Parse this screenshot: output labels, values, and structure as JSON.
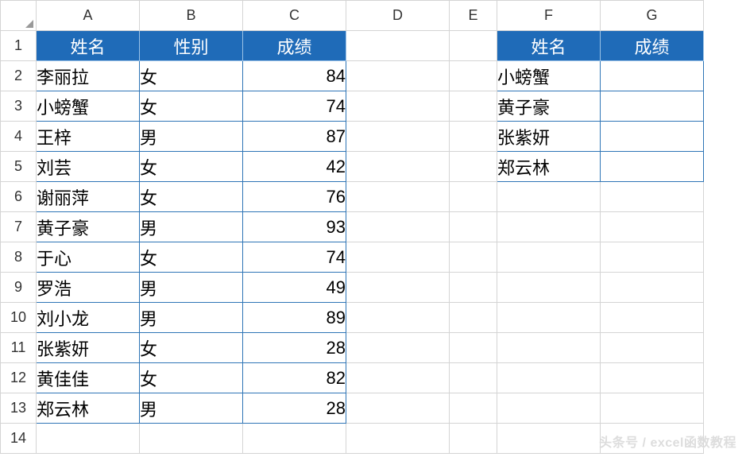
{
  "columns": [
    "A",
    "B",
    "C",
    "D",
    "E",
    "F",
    "G"
  ],
  "rows": [
    "1",
    "2",
    "3",
    "4",
    "5",
    "6",
    "7",
    "8",
    "9",
    "10",
    "11",
    "12",
    "13",
    "14"
  ],
  "table1": {
    "headers": {
      "name": "姓名",
      "gender": "性别",
      "score": "成绩"
    },
    "rows": [
      {
        "name": "李丽拉",
        "gender": "女",
        "score": "84"
      },
      {
        "name": "小螃蟹",
        "gender": "女",
        "score": "74"
      },
      {
        "name": "王梓",
        "gender": "男",
        "score": "87"
      },
      {
        "name": "刘芸",
        "gender": "女",
        "score": "42"
      },
      {
        "name": "谢丽萍",
        "gender": "女",
        "score": "76"
      },
      {
        "name": "黄子豪",
        "gender": "男",
        "score": "93"
      },
      {
        "name": "于心",
        "gender": "女",
        "score": "74"
      },
      {
        "name": "罗浩",
        "gender": "男",
        "score": "49"
      },
      {
        "name": "刘小龙",
        "gender": "男",
        "score": "89"
      },
      {
        "name": "张紫妍",
        "gender": "女",
        "score": "28"
      },
      {
        "name": "黄佳佳",
        "gender": "女",
        "score": "82"
      },
      {
        "name": "郑云林",
        "gender": "男",
        "score": "28"
      }
    ]
  },
  "table2": {
    "headers": {
      "name": "姓名",
      "score": "成绩"
    },
    "rows": [
      {
        "name": "小螃蟹",
        "score": ""
      },
      {
        "name": "黄子豪",
        "score": ""
      },
      {
        "name": "张紫妍",
        "score": ""
      },
      {
        "name": "郑云林",
        "score": ""
      }
    ]
  },
  "watermark": "头条号 / excel函数教程",
  "chart_data": {
    "type": "table",
    "tables": [
      {
        "name": "main",
        "columns": [
          "姓名",
          "性别",
          "成绩"
        ],
        "rows": [
          [
            "李丽拉",
            "女",
            84
          ],
          [
            "小螃蟹",
            "女",
            74
          ],
          [
            "王梓",
            "男",
            87
          ],
          [
            "刘芸",
            "女",
            42
          ],
          [
            "谢丽萍",
            "女",
            76
          ],
          [
            "黄子豪",
            "男",
            93
          ],
          [
            "于心",
            "女",
            74
          ],
          [
            "罗浩",
            "男",
            49
          ],
          [
            "刘小龙",
            "男",
            89
          ],
          [
            "张紫妍",
            "女",
            28
          ],
          [
            "黄佳佳",
            "女",
            82
          ],
          [
            "郑云林",
            "男",
            28
          ]
        ]
      },
      {
        "name": "lookup",
        "columns": [
          "姓名",
          "成绩"
        ],
        "rows": [
          [
            "小螃蟹",
            null
          ],
          [
            "黄子豪",
            null
          ],
          [
            "张紫妍",
            null
          ],
          [
            "郑云林",
            null
          ]
        ]
      }
    ]
  }
}
